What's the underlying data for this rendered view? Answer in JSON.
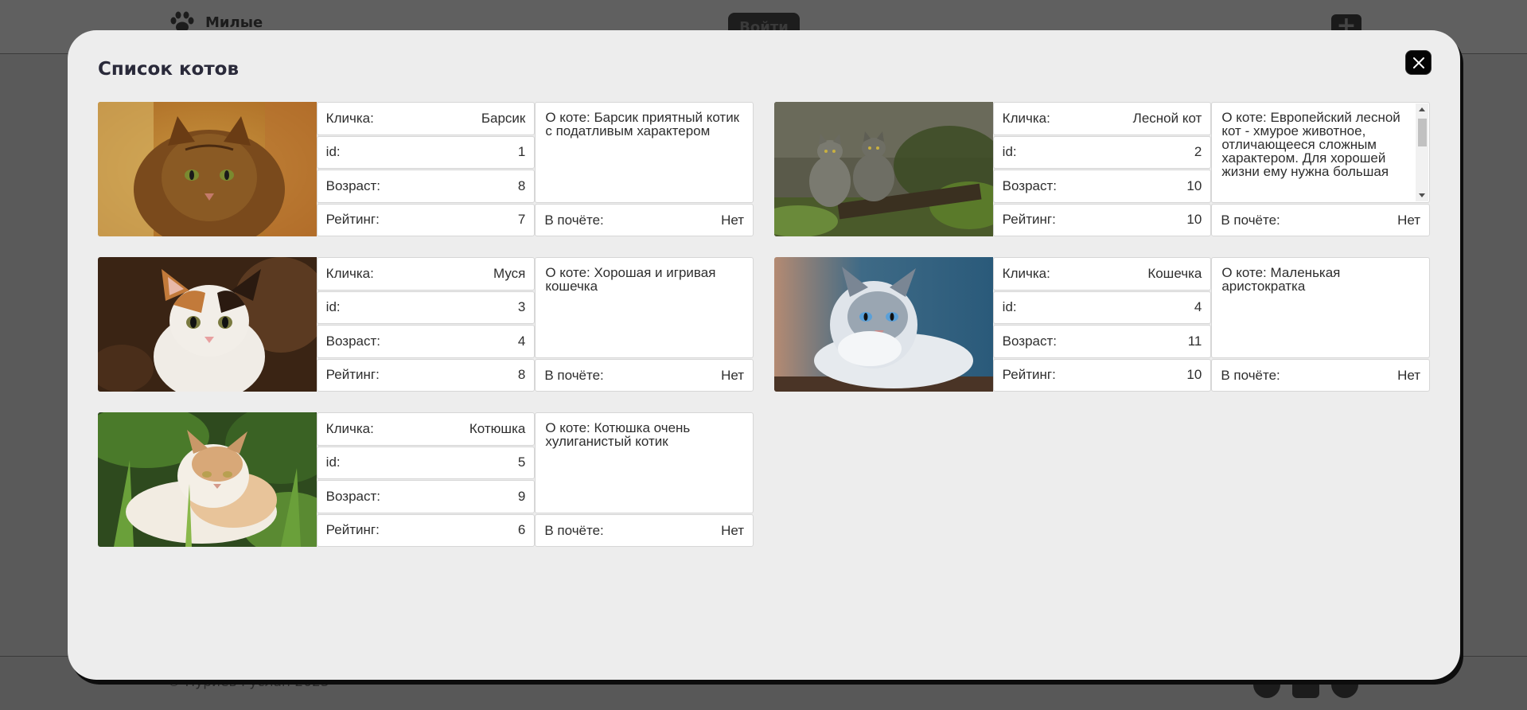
{
  "background": {
    "logo_text": "Милые",
    "login_label": "Войти",
    "add_label": "+",
    "copyright": "© Нуриев Руслан 2023"
  },
  "modal": {
    "title": "Список котов",
    "close_label": "×"
  },
  "labels": {
    "name": "Кличка:",
    "id": "id:",
    "age": "Возраст:",
    "rating": "Рейтинг:",
    "honor": "В почёте:"
  },
  "cats": [
    {
      "name": "Барсик",
      "id": "1",
      "age": "8",
      "rating": "7",
      "about": "О коте: Барсик приятный котик с податливым характером",
      "honor": "Нет",
      "photo": "tabby-cat-photo"
    },
    {
      "name": "Лесной кот",
      "id": "2",
      "age": "10",
      "rating": "10",
      "about": "О коте: Европейский лесной кот - хмурое животное, отличающееся сложным характером. Для хорошей жизни ему нужна большая",
      "honor": "Нет",
      "photo": "wildcats-photo"
    },
    {
      "name": "Муся",
      "id": "3",
      "age": "4",
      "rating": "8",
      "about": "О коте: Хорошая и игривая кошечка",
      "honor": "Нет",
      "photo": "calico-cat-photo"
    },
    {
      "name": "Кошечка",
      "id": "4",
      "age": "11",
      "rating": "10",
      "about": "О коте: Маленькая аристократка",
      "honor": "Нет",
      "photo": "siberian-cat-photo"
    },
    {
      "name": "Котюшка",
      "id": "5",
      "age": "9",
      "rating": "6",
      "about": "О коте: Котюшка очень хулиганистый котик",
      "honor": "Нет",
      "photo": "fluffy-cat-photo"
    }
  ]
}
